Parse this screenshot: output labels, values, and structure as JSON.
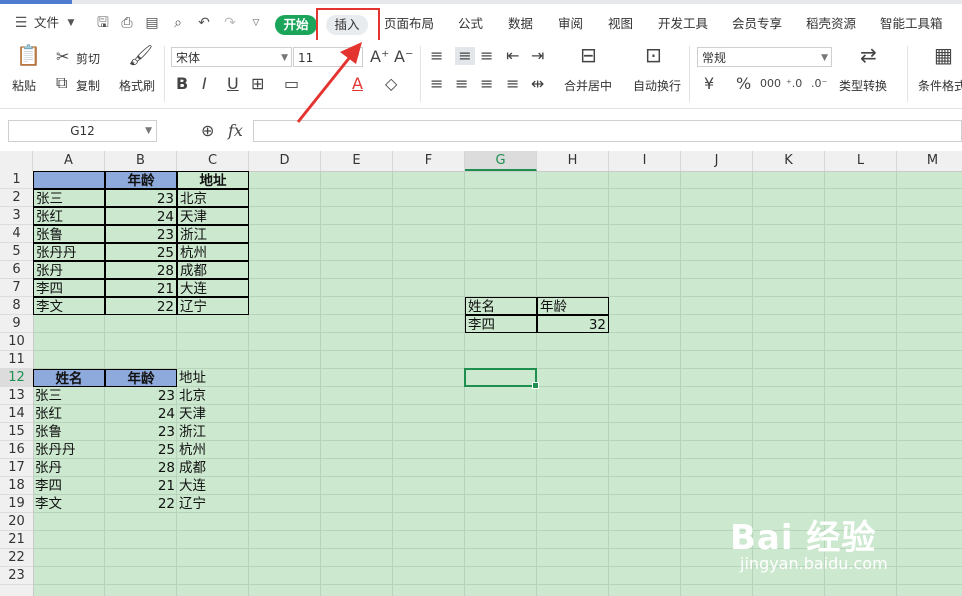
{
  "menubar": {
    "file_menu": "文件",
    "tabs": [
      "开始",
      "插入",
      "页面布局",
      "公式",
      "数据",
      "审阅",
      "视图",
      "开发工具",
      "会员专享",
      "稻壳资源",
      "智能工具箱"
    ],
    "active_tab": "开始",
    "highlighted_tab": "插入"
  },
  "ribbon": {
    "paste": "粘贴",
    "cut": "剪切",
    "copy": "复制",
    "format_painter": "格式刷",
    "font_name": "宋体",
    "font_size": "11",
    "increase_font": "A⁺",
    "decrease_font": "A⁻",
    "bold": "B",
    "italic": "I",
    "underline": "U",
    "merge_center": "合并居中",
    "wrap_text": "自动换行",
    "number_format": "常规",
    "currency": "¥",
    "percent": "%",
    "thousands": "000",
    "type_convert": "类型转换",
    "conditional_format": "条件格式"
  },
  "formula_bar": {
    "cell_ref": "G12",
    "fx": "fx",
    "formula": ""
  },
  "grid": {
    "columns": [
      "A",
      "B",
      "C",
      "D",
      "E",
      "F",
      "G",
      "H",
      "I",
      "J",
      "K",
      "L",
      "M"
    ],
    "active_column": "G",
    "rows": [
      "1",
      "2",
      "3",
      "4",
      "5",
      "6",
      "7",
      "8",
      "9",
      "10",
      "11",
      "12",
      "13",
      "14",
      "15",
      "16",
      "17",
      "18",
      "19",
      "20",
      "21",
      "22",
      "23"
    ],
    "active_row": "12",
    "table1": {
      "headers": [
        "",
        "年龄",
        "地址"
      ],
      "rows": [
        [
          "张三",
          "23",
          "北京"
        ],
        [
          "张红",
          "24",
          "天津"
        ],
        [
          "张鲁",
          "23",
          "浙江"
        ],
        [
          "张丹丹",
          "25",
          "杭州"
        ],
        [
          "张丹",
          "28",
          "成都"
        ],
        [
          "李四",
          "21",
          "大连"
        ],
        [
          "李文",
          "22",
          "辽宁"
        ]
      ]
    },
    "table2": {
      "headers": [
        "姓名",
        "年龄",
        "地址"
      ],
      "rows": [
        [
          "张三",
          "23",
          "北京"
        ],
        [
          "张红",
          "24",
          "天津"
        ],
        [
          "张鲁",
          "23",
          "浙江"
        ],
        [
          "张丹丹",
          "25",
          "杭州"
        ],
        [
          "张丹",
          "28",
          "成都"
        ],
        [
          "李四",
          "21",
          "大连"
        ],
        [
          "李文",
          "22",
          "辽宁"
        ]
      ]
    },
    "lookup": {
      "headers": [
        "姓名",
        "年龄"
      ],
      "row": [
        "李四",
        "32"
      ]
    }
  },
  "watermark": {
    "brand": "Bai 经验",
    "url": "jingyan.baidu.com"
  },
  "colors": {
    "accent": "#1aa55a",
    "annotation": "#e3342f",
    "header_fill": "#8ea9db",
    "sheet_bg": "#cce8cf"
  }
}
